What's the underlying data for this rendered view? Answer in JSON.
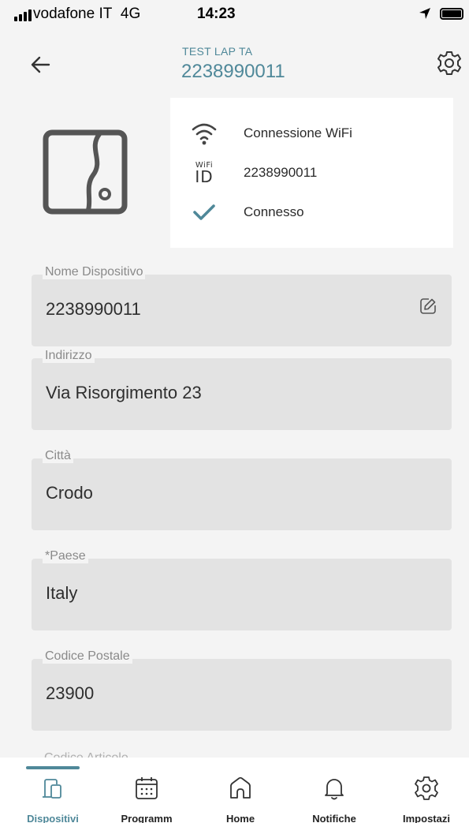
{
  "status_bar": {
    "carrier": "vodafone IT",
    "network": "4G",
    "time": "14:23"
  },
  "header": {
    "subtitle": "TEST LAP TA",
    "title": "2238990011",
    "back_icon": "arrow-left-icon",
    "settings_icon": "gear-icon"
  },
  "device": {
    "icon": "door-device-icon",
    "connection": {
      "type_label": "Connessione WiFi",
      "id_value": "2238990011",
      "status_label": "Connesso",
      "wifi_id_small": "WiFi",
      "wifi_id_big": "ID"
    }
  },
  "fields": [
    {
      "label": "Nome Dispositivo",
      "value": "2238990011",
      "editable": true
    },
    {
      "label": "Indirizzo",
      "value": "Via Risorgimento 23"
    },
    {
      "label": "Città",
      "value": "Crodo"
    },
    {
      "label": "*Paese",
      "value": "Italy"
    },
    {
      "label": "Codice Postale",
      "value": "23900"
    }
  ],
  "partial_field_label": "Codice Articolo",
  "bottom_nav": [
    {
      "label": "Dispositivi",
      "icon": "devices-icon",
      "active": true
    },
    {
      "label": "Programm",
      "icon": "calendar-icon",
      "active": false
    },
    {
      "label": "Home",
      "icon": "home-icon",
      "active": false
    },
    {
      "label": "Notifiche",
      "icon": "bell-icon",
      "active": false
    },
    {
      "label": "Impostazi",
      "icon": "gear-icon",
      "active": false
    }
  ],
  "colors": {
    "accent": "#4f8899",
    "field_bg": "#e3e3e3",
    "page_bg": "#f4f4f4"
  }
}
